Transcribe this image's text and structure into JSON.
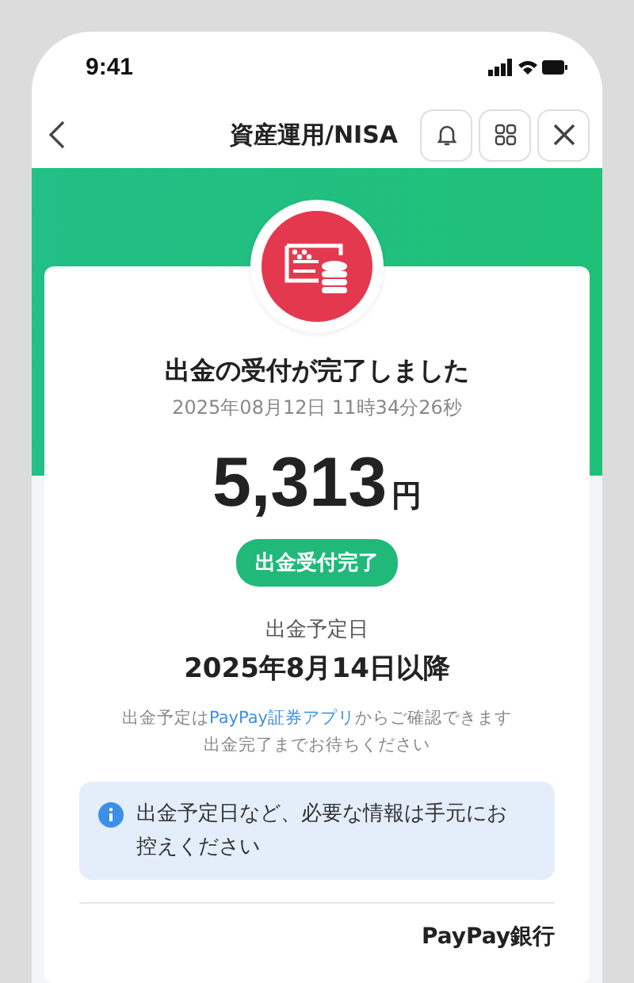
{
  "status_bar": {
    "time": "9:41"
  },
  "header": {
    "title": "資産運用/NISA"
  },
  "result": {
    "title": "出金の受付が完了しました",
    "timestamp": "2025年08月12日 11時34分26秒",
    "amount": "5,313",
    "unit": "円",
    "badge": "出金受付完了"
  },
  "schedule": {
    "label": "出金予定日",
    "date": "2025年8月14日以降",
    "note_before": "出金予定は",
    "note_link": "PayPay証券アプリ",
    "note_after": "からご確認できます",
    "note_line2": "出金完了までお待ちください"
  },
  "info": {
    "text": "出金予定日など、必要な情報は手元にお控えください"
  },
  "destination": {
    "bank": "PayPay銀行"
  }
}
